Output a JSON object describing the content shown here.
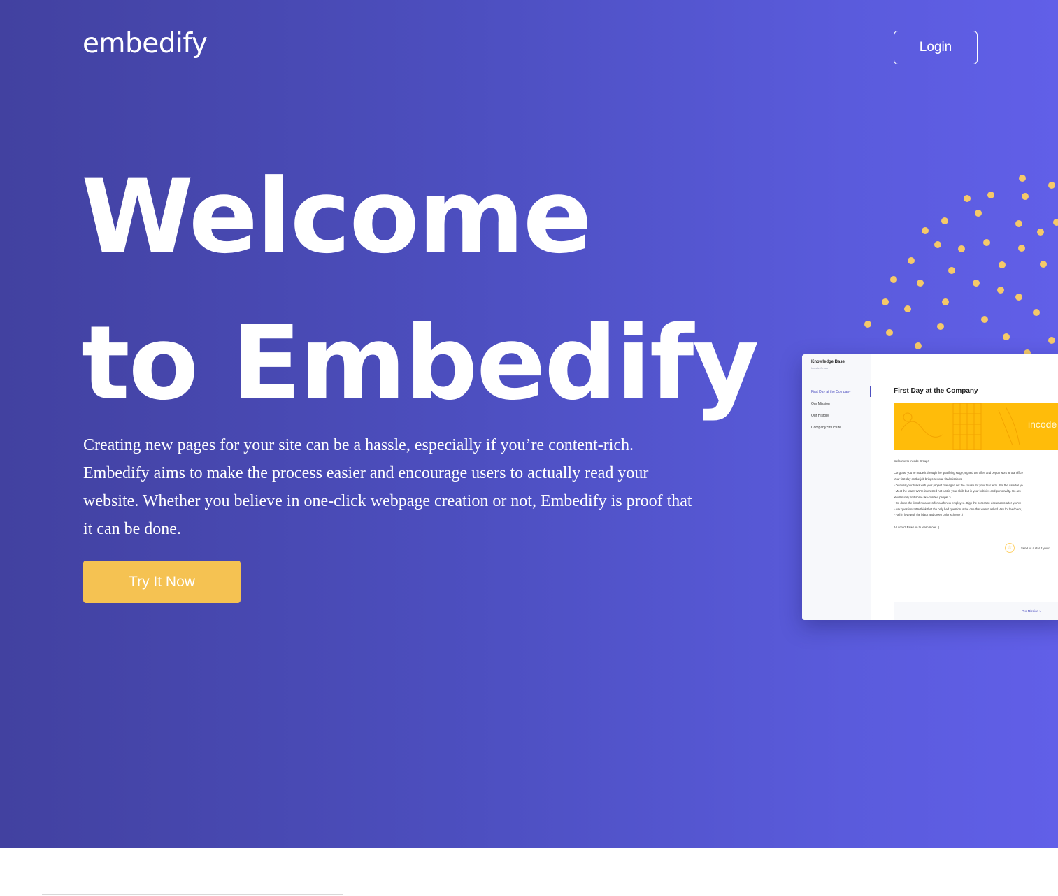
{
  "header": {
    "logo": "embedify",
    "login_label": "Login"
  },
  "hero": {
    "title_line1": "Welcome",
    "title_line2": "to Embedify",
    "description": "Creating new pages for your site can be a hassle, especially if you’re content-rich. Embedify aims to make the process easier and encourage users to actually read your website. Whether you believe in one-click webpage creation or not, Embedify is proof that it can be done.",
    "cta_label": "Try It Now"
  },
  "mockup": {
    "kb_title": "Knowledge Base",
    "kb_subtitle": "Incode Group",
    "sidebar_items": [
      "First Day at the Company",
      "Our Mission",
      "Our History",
      "Company Structure"
    ],
    "heading": "First Day at the Company",
    "banner_text": "incode",
    "lines": [
      "Welcome to Incode Group!",
      "Congrats, you’ve made it through the qualifying stage, signed the offer, and begun work at our office",
      "Your first day on the job brings several vital missions:",
      "• Discuss your tasks with your project manager, set the course for your trial term. Set the date for yo",
      "• Meet the team! We’re interested not just in your skills but in your hobbies and personality. Go aro",
      "You’ll surely find some like-minded people :)",
      "• Go down the list of measures for each new employee. Sign the corporate documents after you’ve",
      "• Ask questions! We think that the only bad question is the one that wasn’t asked. Ask for feedback,",
      "• Fall in love with the black and green color scheme :)",
      "All done? Read on to learn more! :)"
    ],
    "star_text": "Send us a star if you r",
    "next_link": "Our Mission  ›"
  },
  "colors": {
    "hero_gradient_start": "#4241a0",
    "hero_gradient_end": "#615fe8",
    "accent_yellow": "#f5c252",
    "dot_color": "#f5c969"
  }
}
